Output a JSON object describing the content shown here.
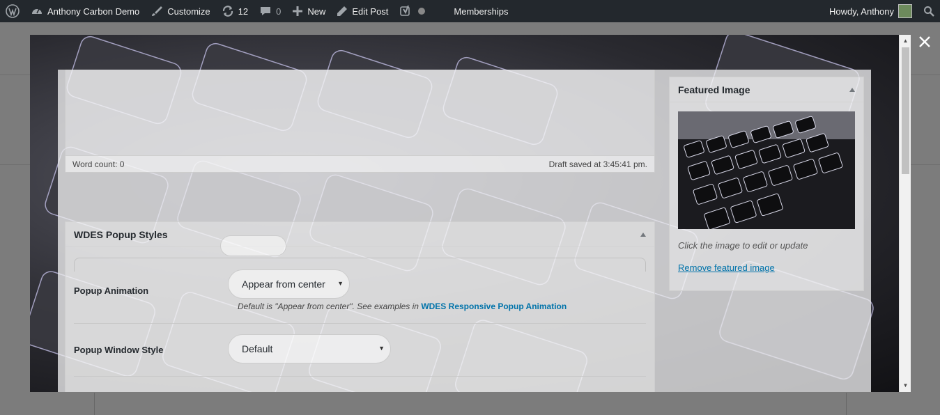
{
  "adminbar": {
    "site_name": "Anthony Carbon Demo",
    "customize": "Customize",
    "updates_count": "12",
    "comments_count": "0",
    "new_label": "New",
    "edit_post": "Edit Post",
    "memberships": "Memberships",
    "howdy": "Howdy, Anthony"
  },
  "editor": {
    "word_count": "Word count: 0",
    "draft_saved": "Draft saved at 3:45:41 pm."
  },
  "popup_styles": {
    "title": "WDES Popup Styles",
    "animation_label": "Popup Animation",
    "animation_value": "Appear from center",
    "animation_hint": "Default is \"Appear from center\". See examples in ",
    "animation_link": "WDES Responsive Popup Animation",
    "window_style_label": "Popup Window Style",
    "window_style_value": "Default"
  },
  "featured_image": {
    "title": "Featured Image",
    "caption": "Click the image to edit or update",
    "remove_link": "Remove featured image"
  },
  "colors": {
    "adminbar_bg": "#23282d",
    "link": "#0073aa"
  }
}
